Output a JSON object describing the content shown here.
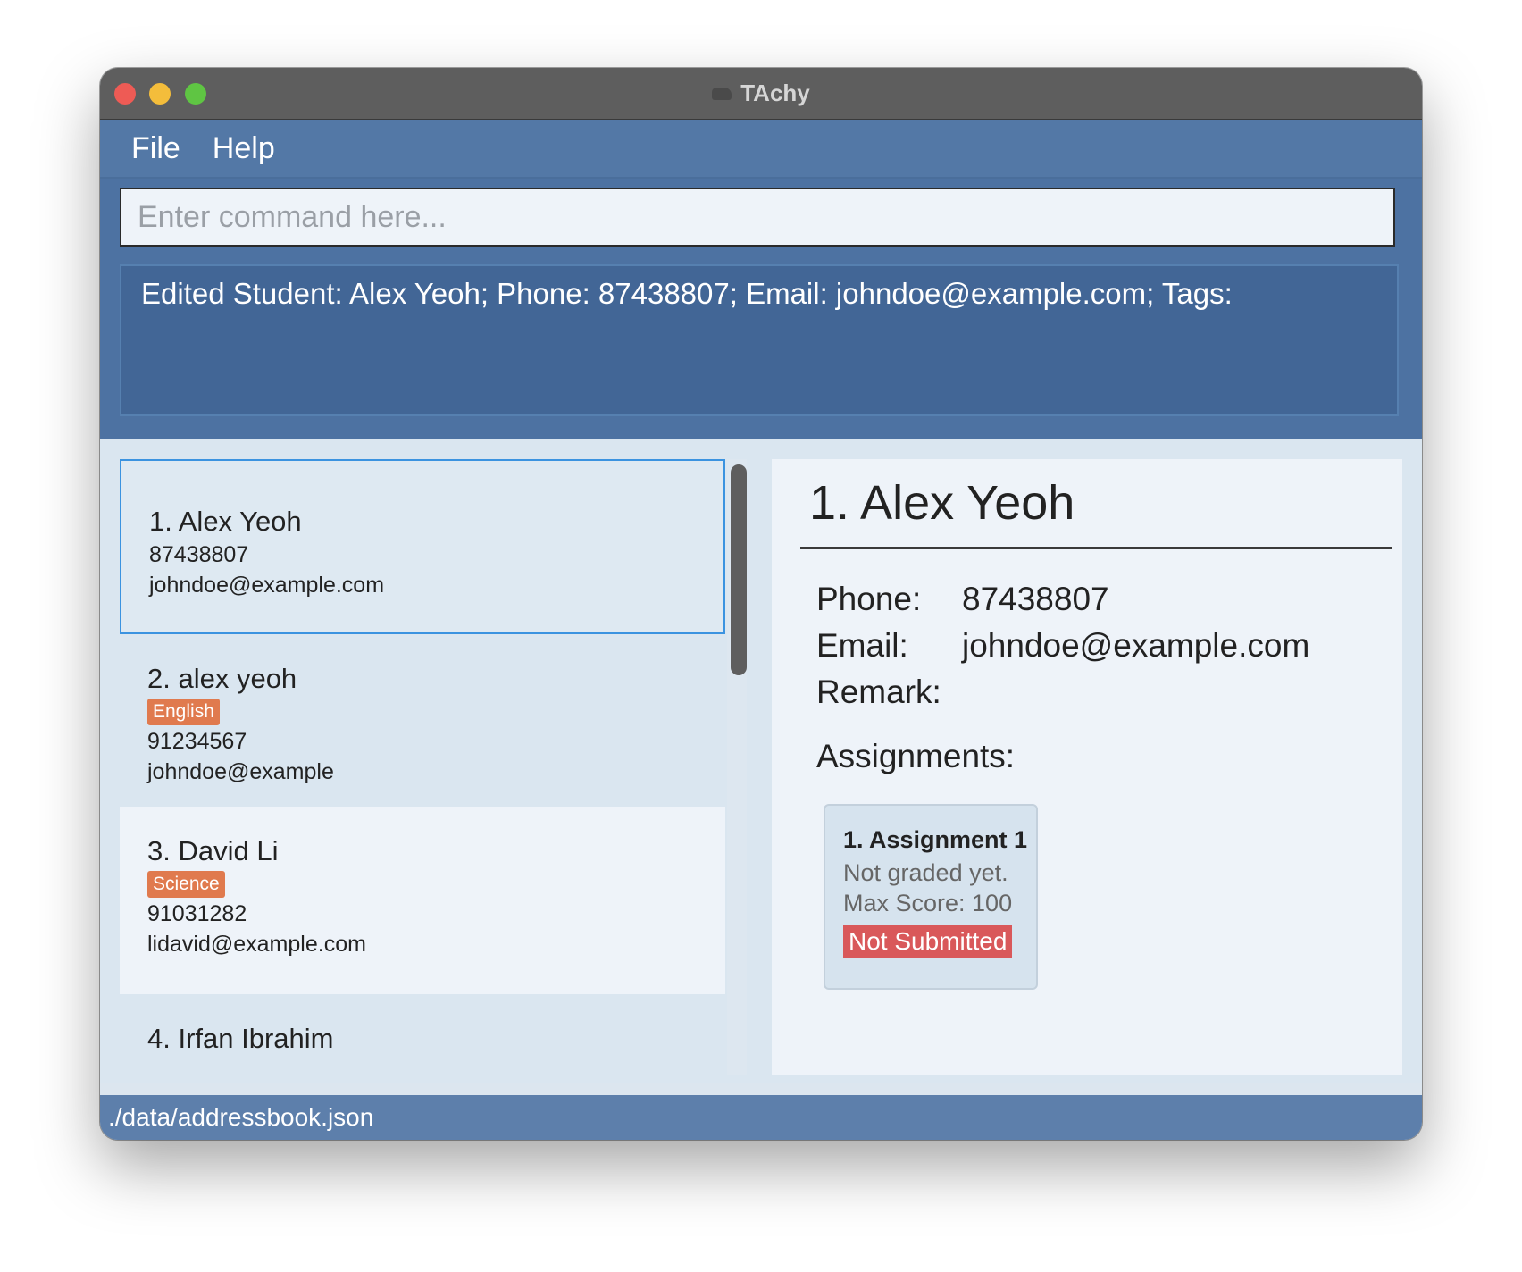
{
  "window": {
    "title": "TAchy"
  },
  "menu": {
    "file": "File",
    "help": "Help"
  },
  "command": {
    "placeholder": "Enter command here...",
    "value": ""
  },
  "result": {
    "text": "Edited Student: Alex Yeoh; Phone: 87438807; Email: johndoe@example.com; Tags:"
  },
  "students": [
    {
      "name": "1. Alex Yeoh",
      "tag": "",
      "phone": "87438807",
      "email": "johndoe@example.com"
    },
    {
      "name": "2. alex yeoh",
      "tag": "English",
      "phone": "91234567",
      "email": "johndoe@example"
    },
    {
      "name": "3. David Li",
      "tag": "Science",
      "phone": "91031282",
      "email": "lidavid@example.com"
    },
    {
      "name": "4. Irfan Ibrahim"
    }
  ],
  "detail": {
    "title": "1. Alex Yeoh",
    "phone_label": "Phone:",
    "phone": "87438807",
    "email_label": "Email:",
    "email": "johndoe@example.com",
    "remark_label": "Remark:",
    "remark": "",
    "assignments_label": "Assignments:",
    "assignments": [
      {
        "title": "1. Assignment 1",
        "grade": "Not graded yet.",
        "max_score": "Max Score: 100",
        "status": "Not Submitted"
      }
    ]
  },
  "status_bar": {
    "path": "./data/addressbook.json"
  },
  "colors": {
    "menubar": "#5378a6",
    "result_box": "#426696",
    "tag": "#e07a4e",
    "not_submitted": "#d9585a",
    "selection": "#3b93e0"
  }
}
